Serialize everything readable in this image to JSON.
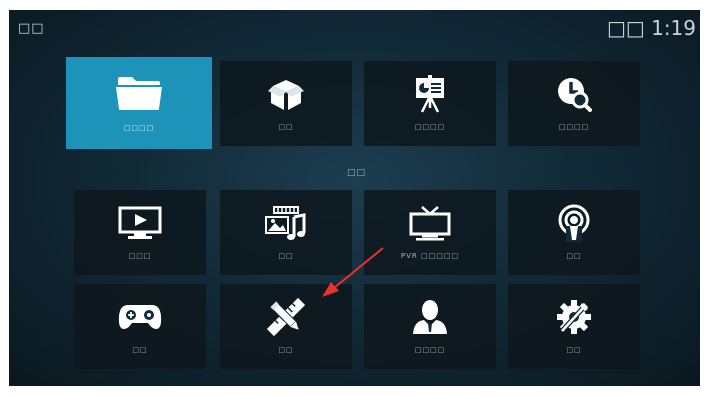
{
  "header": {
    "title": "□□",
    "clock": "□□ 1:19"
  },
  "top_row": [
    {
      "label": "□□□□",
      "icon": "folder-icon",
      "selected": true
    },
    {
      "label": "□□",
      "icon": "box-icon"
    },
    {
      "label": "□□□□",
      "icon": "presentation-icon"
    },
    {
      "label": "□□□□",
      "icon": "clock-search-icon"
    }
  ],
  "section_label": "□□",
  "middle_row": [
    {
      "label": "□□□",
      "icon": "tv-play-icon"
    },
    {
      "label": "□□",
      "icon": "pictures-music-icon"
    },
    {
      "label": "PVR □□□□□",
      "icon": "retro-tv-icon"
    },
    {
      "label": "□□",
      "icon": "podcast-icon"
    }
  ],
  "bottom_row": [
    {
      "label": "□□",
      "icon": "gamepad-icon"
    },
    {
      "label": "□□",
      "icon": "pencil-ruler-icon"
    },
    {
      "label": "□□□□",
      "icon": "user-icon"
    },
    {
      "label": "□□",
      "icon": "settings-tools-icon"
    }
  ],
  "colors": {
    "selected_tile": "#1d93b9",
    "annotation_arrow": "#e8322e"
  }
}
